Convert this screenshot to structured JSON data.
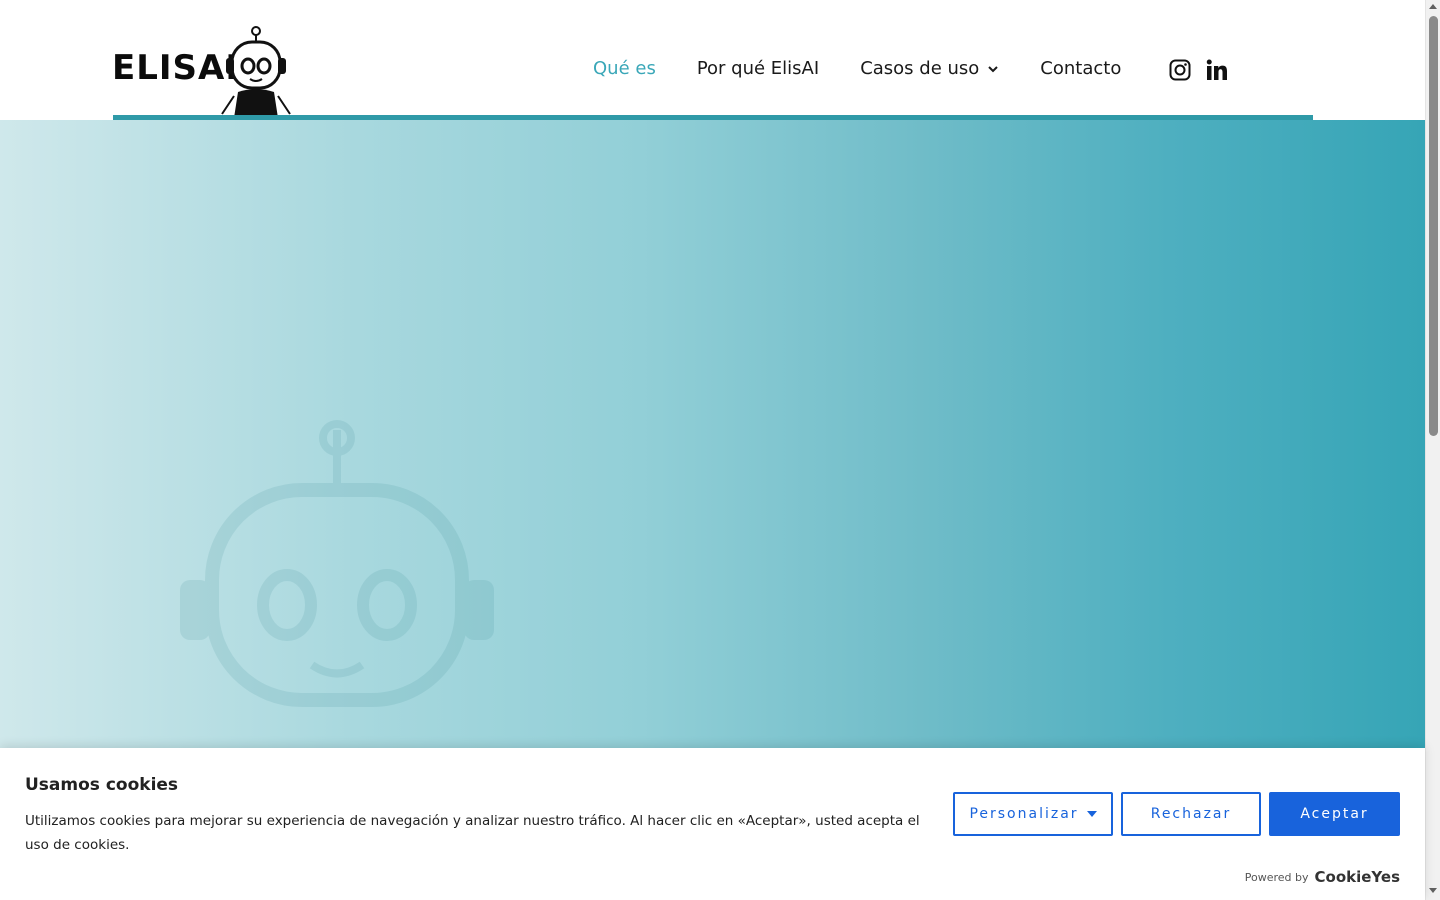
{
  "header": {
    "logo_text": "ELISAI",
    "nav": [
      {
        "label": "Qué es",
        "active": true
      },
      {
        "label": "Por qué ElisAI",
        "active": false
      },
      {
        "label": "Casos de uso",
        "active": false,
        "has_dropdown": true
      },
      {
        "label": "Contacto",
        "active": false
      }
    ],
    "social": [
      "instagram-icon",
      "linkedin-icon"
    ]
  },
  "colors": {
    "accent": "#3aa7b8",
    "header_line": "#2f9aa8",
    "hero_gradient_start": "#cfe8eb",
    "hero_gradient_end": "#36a5b6",
    "cookie_button_blue": "#1863dc"
  },
  "cookie_banner": {
    "title": "Usamos cookies",
    "text": "Utilizamos cookies para mejorar su experiencia de navegación y analizar nuestro tráfico. Al hacer clic en «Aceptar», usted acepta el uso de cookies.",
    "buttons": {
      "customize": "Personalizar",
      "reject": "Rechazar",
      "accept": "Aceptar"
    },
    "powered_by": "Powered by",
    "brand": "CookieYes"
  }
}
